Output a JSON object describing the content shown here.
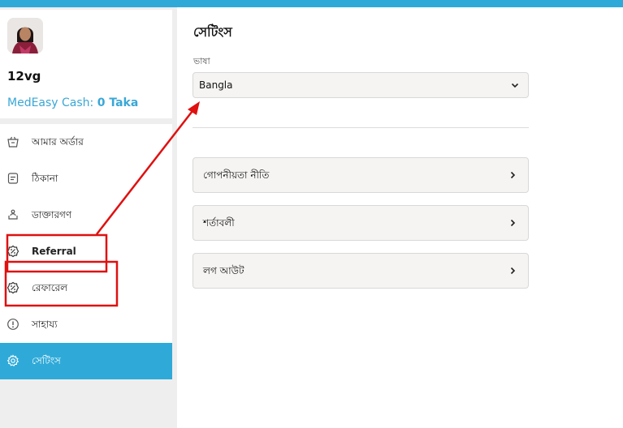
{
  "profile": {
    "username": "12vg",
    "cash_label": "MedEasy Cash: ",
    "cash_value": "0 Taka"
  },
  "sidebar": {
    "items": [
      {
        "label": "আমার অর্ডার",
        "icon": "basket-icon"
      },
      {
        "label": "ঠিকানা",
        "icon": "document-icon"
      },
      {
        "label": "ডাক্তারগণ",
        "icon": "doctor-icon"
      },
      {
        "label": "Referral",
        "icon": "referral-icon"
      },
      {
        "label": "রেফারেল",
        "icon": "referral-icon"
      },
      {
        "label": "সাহায্য",
        "icon": "info-icon"
      },
      {
        "label": "সেটিংস",
        "icon": "gear-icon",
        "active": true
      }
    ]
  },
  "main": {
    "title": "সেটিংস",
    "language_label": "ভাষা",
    "language_value": "Bangla",
    "links": [
      "গোপনীয়তা নীতি",
      "শর্তাবলী",
      "লগ আউট"
    ]
  },
  "colors": {
    "accent": "#2faad8",
    "annotation": "#e01010"
  }
}
